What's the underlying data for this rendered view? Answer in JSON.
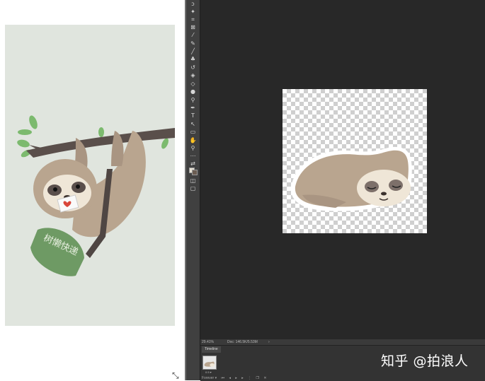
{
  "left_pane": {
    "poster": {
      "illustration": "sloth-hanging-from-branch",
      "satchel_text": "树懒快递",
      "colors": {
        "background": "#e0e5de",
        "branch": "#5a4f4b",
        "leaf": "#7cba6e",
        "fur": "#b9a58f",
        "bag": "#6e9a64"
      }
    }
  },
  "photoshop": {
    "toolbar": {
      "tools": [
        "lasso-icon",
        "magic-wand-icon",
        "crop-icon",
        "slice-icon",
        "eyedropper-icon",
        "healing-brush-icon",
        "brush-icon",
        "clone-stamp-icon",
        "history-brush-icon",
        "eraser-icon",
        "paint-bucket-icon",
        "blur-icon",
        "dodge-icon",
        "pen-icon",
        "type-icon",
        "path-selection-icon",
        "shape-icon",
        "hand-icon",
        "zoom-icon",
        "ellipsis-icon",
        "swap-colors-icon",
        "color-swatches-icon",
        "quick-mask-icon",
        "screen-mode-icon"
      ]
    },
    "document": {
      "illustration": "sloth-sleeping",
      "transparent_background": true
    },
    "status_bar": {
      "zoom": "29.41%",
      "doc_size": "Doc: 146.5K/5.53M"
    },
    "timeline": {
      "tab_label": "Timeline",
      "frame_delay": "0.5 ▾",
      "loop_option": "Forever ▾"
    }
  },
  "watermark": "知乎 @拍浪人",
  "colors": {
    "panel_dark": "#282828",
    "toolbar": "#404040",
    "timeline": "#333333"
  }
}
